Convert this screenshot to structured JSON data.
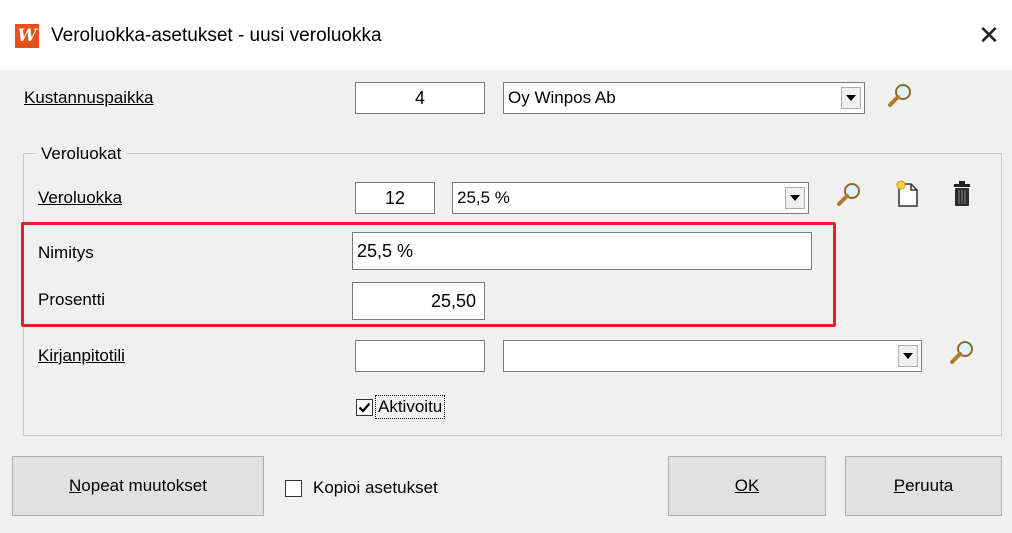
{
  "window": {
    "app_logo": "W",
    "title": "Veroluokka-asetukset - uusi veroluokka",
    "close_glyph": "✕"
  },
  "kustannuspaikka": {
    "label": "Kustannuspaikka",
    "code": "4",
    "selected": "Oy Winpos Ab",
    "search_icon": "magnifier-icon"
  },
  "veroluokat_group": {
    "title": "Veroluokat",
    "veroluokka": {
      "label": "Veroluokka",
      "code": "12",
      "selected": "25,5 %",
      "icons": [
        "magnifier-icon",
        "new-document-icon",
        "trash-icon"
      ]
    },
    "nimitys": {
      "label": "Nimitys",
      "value": "25,5 %"
    },
    "prosentti": {
      "label": "Prosentti",
      "value": "25,50"
    },
    "kirjanpitotili": {
      "label": "Kirjanpitotili",
      "code": "",
      "selected": ""
    },
    "aktivoitu": {
      "label": "Aktivoitu",
      "checked": true
    }
  },
  "highlight_color": "#e4202e",
  "footer": {
    "quick_changes": "Nopeat muutokset",
    "copy_settings": {
      "label": "Kopioi asetukset",
      "checked": false
    },
    "ok": "OK",
    "cancel": "Peruuta"
  }
}
